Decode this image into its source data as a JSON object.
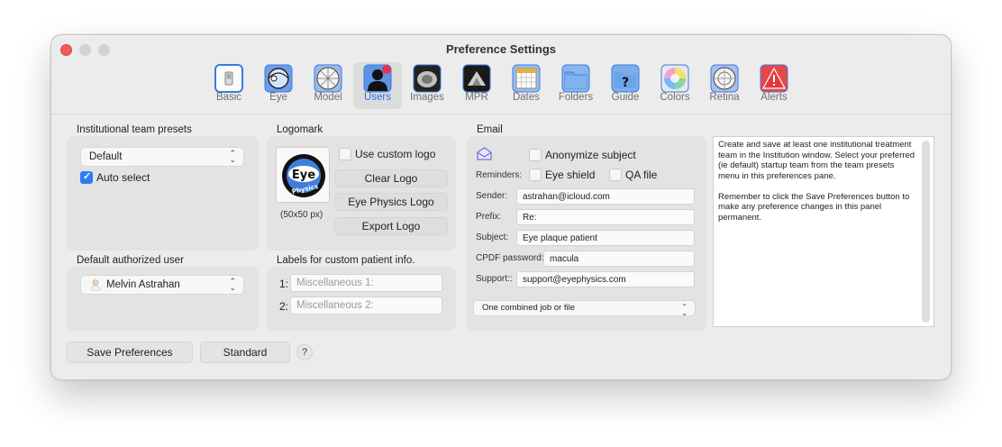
{
  "window": {
    "title": "Preference Settings"
  },
  "toolbar": [
    {
      "label": "Basic",
      "icon": "switch-icon"
    },
    {
      "label": "Eye",
      "icon": "eye-icon"
    },
    {
      "label": "Model",
      "icon": "model-icon"
    },
    {
      "label": "Users",
      "icon": "users-icon",
      "selected": true
    },
    {
      "label": "Images",
      "icon": "images-icon"
    },
    {
      "label": "MPR",
      "icon": "mpr-icon"
    },
    {
      "label": "Dates",
      "icon": "calendar-icon"
    },
    {
      "label": "Folders",
      "icon": "folder-icon"
    },
    {
      "label": "Guide",
      "icon": "guide-icon"
    },
    {
      "label": "Colors",
      "icon": "color-wheel-icon"
    },
    {
      "label": "Retina",
      "icon": "retina-icon"
    },
    {
      "label": "Alerts",
      "icon": "alert-icon"
    }
  ],
  "team": {
    "title": "Institutional team presets",
    "preset": "Default",
    "auto_select_label": "Auto select",
    "auto_select": true
  },
  "default_user": {
    "title": "Default authorized user",
    "user": "Melvin Astrahan"
  },
  "logomark": {
    "title": "Logomark",
    "size_label": "(50x50 px)",
    "use_custom_label": "Use custom logo",
    "clear_label": "Clear Logo",
    "eye_physics_label": "Eye Physics Logo",
    "export_label": "Export Logo",
    "logo_text_top": "Eye",
    "logo_text_bottom": "Physics"
  },
  "custom_labels": {
    "title": "Labels for custom patient info.",
    "rows": [
      {
        "num": "1:",
        "placeholder": "Miscellaneous 1:"
      },
      {
        "num": "2:",
        "placeholder": "Miscellaneous 2:"
      }
    ]
  },
  "email": {
    "title": "Email",
    "anonymize_label": "Anonymize subject",
    "reminders_label": "Reminders:",
    "eye_shield_label": "Eye shield",
    "qa_file_label": "QA file",
    "sender_label": "Sender:",
    "sender": "astrahan@icloud.com",
    "prefix_label": "Prefix:",
    "prefix": "Re:",
    "subject_label": "Subject:",
    "subject": "Eye plaque patient",
    "cpdf_label": "CPDF password:",
    "cpdf": "macula",
    "support_label": "Support::",
    "support": "support@eyephysics.com",
    "mode": "One combined job or file"
  },
  "help_text": "Create and save at least one institutional treatment team in the Institution window. Select your preferred (ie default) startup team from the team presets menu in this preferences pane.\n\nRemember to click the Save Preferences button to make any preference changes in this panel permanent.",
  "footer": {
    "save_label": "Save Preferences",
    "standard_label": "Standard",
    "help_label": "?"
  },
  "colors": {
    "accent": "#2e7cf6",
    "close": "#ec5f57"
  }
}
